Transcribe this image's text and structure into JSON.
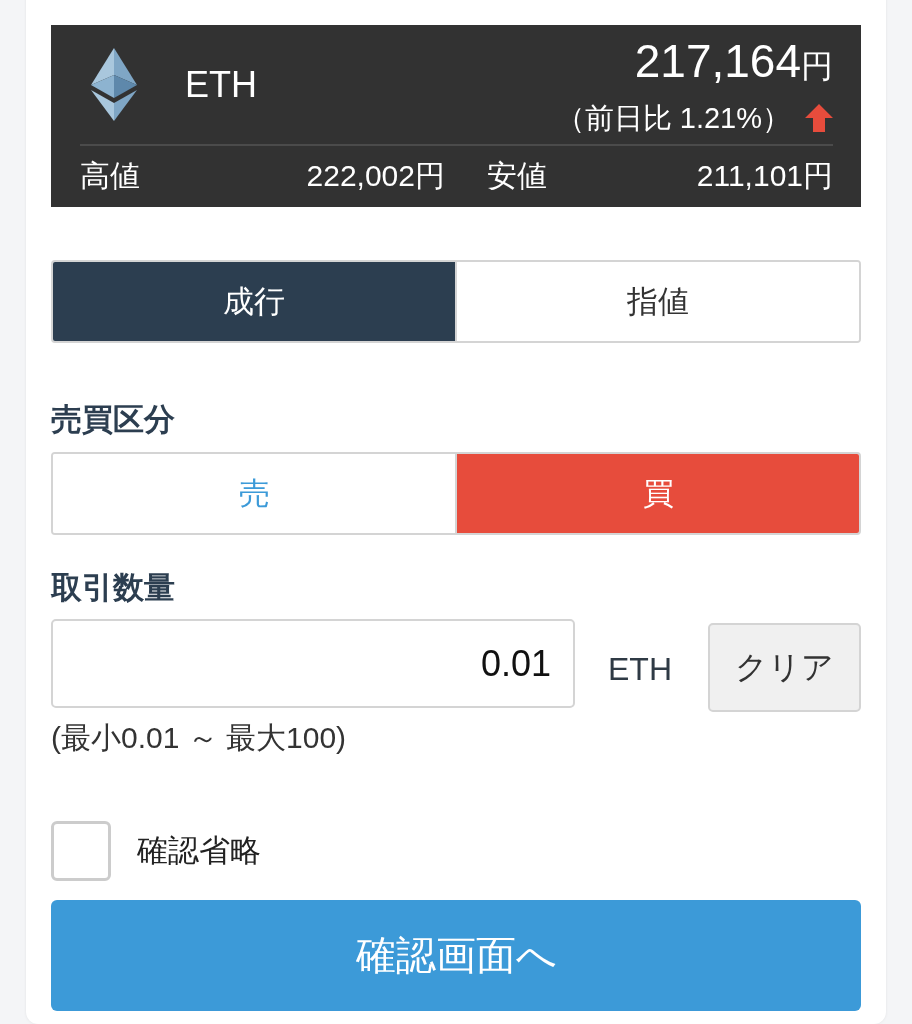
{
  "ticker": {
    "symbol": "ETH",
    "price": "217,164",
    "price_unit": "円",
    "change": "（前日比 1.21%）",
    "rising": true,
    "high_label": "高値",
    "high": "222,002円",
    "low_label": "安値",
    "low": "211,101円"
  },
  "order_type_tabs": [
    {
      "label": "成行",
      "selected": true
    },
    {
      "label": "指値",
      "selected": false
    }
  ],
  "side": {
    "label": "売買区分",
    "options": [
      {
        "label": "売",
        "kind": "sell",
        "selected": false
      },
      {
        "label": "買",
        "kind": "buy",
        "selected": true
      }
    ]
  },
  "quantity": {
    "label": "取引数量",
    "value": "0.01",
    "unit": "ETH",
    "clear_button": "クリア",
    "range": "(最小0.01 ～ 最大100)"
  },
  "skip_confirmation": {
    "label": "確認省略",
    "checked": false
  },
  "submit_button": "確認画面へ"
}
